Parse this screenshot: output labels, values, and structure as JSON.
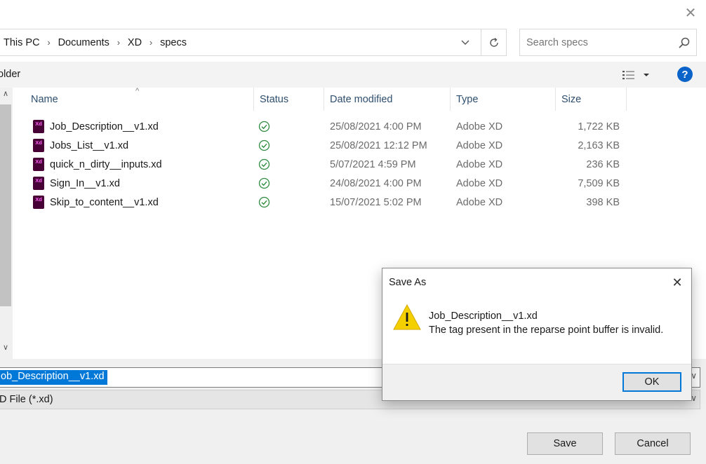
{
  "window": {
    "close_glyph": "✕"
  },
  "address": {
    "crumbs": [
      "This PC",
      "Documents",
      "XD",
      "specs"
    ],
    "separator": "›"
  },
  "search": {
    "placeholder": "Search specs"
  },
  "toolbar": {
    "new_folder_label": "older",
    "help_label": "?"
  },
  "columns": {
    "name": "Name",
    "status": "Status",
    "date": "Date modified",
    "type": "Type",
    "size": "Size"
  },
  "files": [
    {
      "name": "Job_Description__v1.xd",
      "date": "25/08/2021 4:00 PM",
      "type": "Adobe XD",
      "size": "1,722 KB"
    },
    {
      "name": "Jobs_List__v1.xd",
      "date": "25/08/2021 12:12 PM",
      "type": "Adobe XD",
      "size": "2,163 KB"
    },
    {
      "name": "quick_n_dirty__inputs.xd",
      "date": "5/07/2021 4:59 PM",
      "type": "Adobe XD",
      "size": "236 KB"
    },
    {
      "name": "Sign_In__v1.xd",
      "date": "24/08/2021 4:00 PM",
      "type": "Adobe XD",
      "size": "7,509 KB"
    },
    {
      "name": "Skip_to_content__v1.xd",
      "date": "15/07/2021 5:02 PM",
      "type": "Adobe XD",
      "size": "398 KB"
    }
  ],
  "file_icon_label": "Xd",
  "filename": {
    "value": "ob_Description__v1.xd"
  },
  "filetype": {
    "value": "D File (*.xd)"
  },
  "buttons": {
    "save": "Save",
    "cancel": "Cancel"
  },
  "dialog": {
    "title": "Save As",
    "file": "Job_Description__v1.xd",
    "message": "The tag present in the reparse point buffer is invalid.",
    "ok": "OK",
    "close_glyph": "✕"
  },
  "colors": {
    "accent": "#0078d7",
    "status_ok": "#2e8b3e",
    "xd_icon_bg": "#470137",
    "xd_icon_fg": "#ff61f6",
    "warning": "#f5d000"
  }
}
